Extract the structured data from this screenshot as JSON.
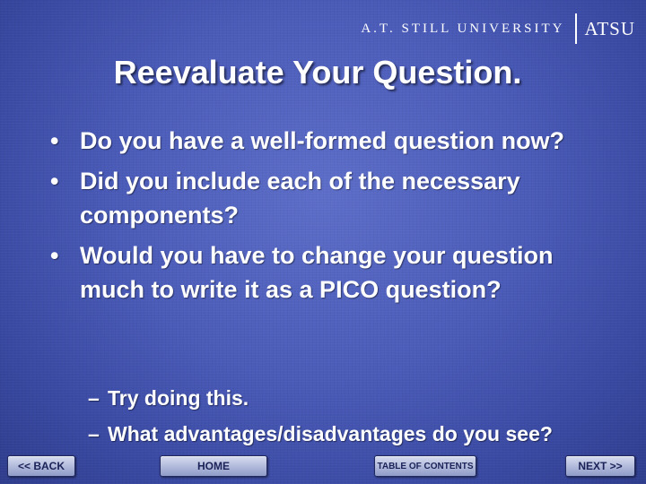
{
  "header": {
    "university": "A.T. STILL UNIVERSITY",
    "acronym": "ATSU"
  },
  "slide": {
    "title": "Reevaluate Your Question.",
    "bullets": [
      {
        "marker": "•",
        "text": "Do you have a well-formed question now?"
      },
      {
        "marker": "•",
        "text": "Did you include each of the necessary components?"
      },
      {
        "marker": "•",
        "text": "Would you have to change your question much to write it as a PICO question?"
      }
    ],
    "sub_bullets": [
      {
        "marker": "–",
        "text": "Try doing this."
      },
      {
        "marker": "–",
        "text": "What advantages/disadvantages do you see?"
      }
    ]
  },
  "nav": {
    "back": "<< BACK",
    "home": "HOME",
    "toc": "TABLE OF CONTENTS",
    "next": "NEXT >>"
  }
}
